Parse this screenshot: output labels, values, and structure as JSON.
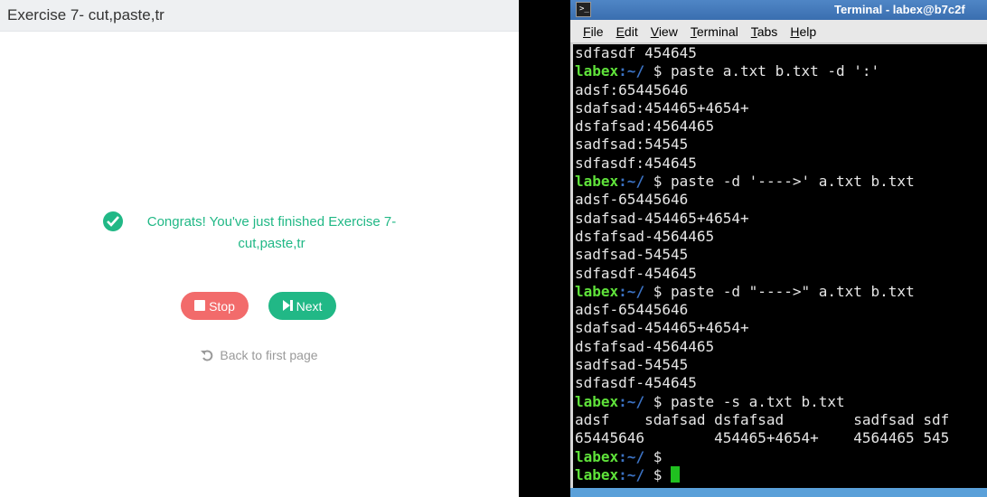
{
  "exercise": {
    "title": "Exercise 7- cut,paste,tr",
    "congrats_text": "Congrats! You've just finished Exercise 7- cut,paste,tr",
    "stop_label": "Stop",
    "next_label": "Next",
    "back_label": "Back to first page",
    "accent_color": "#21b886",
    "stop_color": "#f26b6b"
  },
  "terminal": {
    "title": "Terminal - labex@b7c2f",
    "menu": [
      "File",
      "Edit",
      "View",
      "Terminal",
      "Tabs",
      "Help"
    ],
    "prompt_user": "labex",
    "prompt_path": ":~/",
    "prompt_symbol": " $ ",
    "lines": [
      {
        "type": "out",
        "text": "sdfasdf 454645"
      },
      {
        "type": "cmd",
        "text": "paste a.txt b.txt -d ':'"
      },
      {
        "type": "out",
        "text": "adsf:65445646"
      },
      {
        "type": "out",
        "text": "sdafsad:454465+4654+"
      },
      {
        "type": "out",
        "text": "dsfafsad:4564465"
      },
      {
        "type": "out",
        "text": "sadfsad:54545"
      },
      {
        "type": "out",
        "text": "sdfasdf:454645"
      },
      {
        "type": "cmd",
        "text": "paste -d '---->' a.txt b.txt"
      },
      {
        "type": "out",
        "text": "adsf-65445646"
      },
      {
        "type": "out",
        "text": "sdafsad-454465+4654+"
      },
      {
        "type": "out",
        "text": "dsfafsad-4564465"
      },
      {
        "type": "out",
        "text": "sadfsad-54545"
      },
      {
        "type": "out",
        "text": "sdfasdf-454645"
      },
      {
        "type": "cmd",
        "text": "paste -d \"---->\" a.txt b.txt"
      },
      {
        "type": "out",
        "text": "adsf-65445646"
      },
      {
        "type": "out",
        "text": "sdafsad-454465+4654+"
      },
      {
        "type": "out",
        "text": "dsfafsad-4564465"
      },
      {
        "type": "out",
        "text": "sadfsad-54545"
      },
      {
        "type": "out",
        "text": "sdfasdf-454645"
      },
      {
        "type": "cmd",
        "text": "paste -s a.txt b.txt"
      },
      {
        "type": "out",
        "text": "adsf    sdafsad dsfafsad        sadfsad sdf"
      },
      {
        "type": "out",
        "text": "65445646        454465+4654+    4564465 545"
      },
      {
        "type": "cmd",
        "text": ""
      },
      {
        "type": "cursor",
        "text": ""
      }
    ]
  }
}
